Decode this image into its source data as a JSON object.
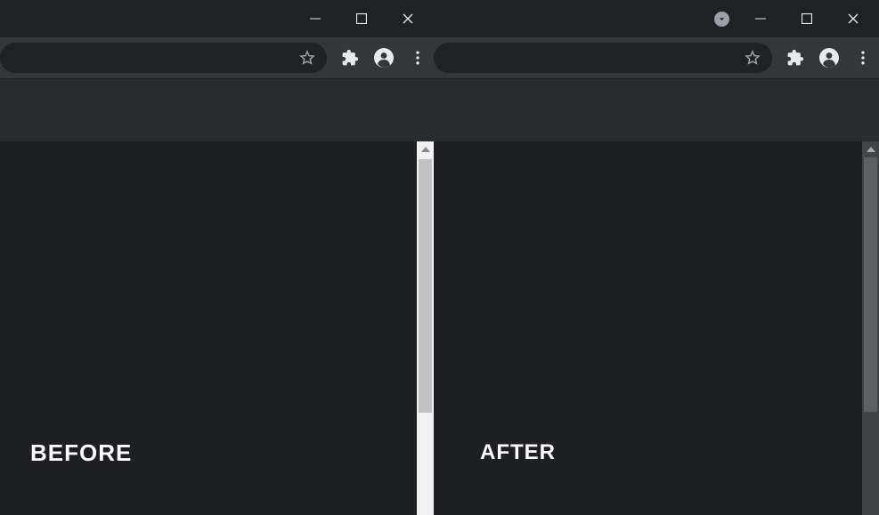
{
  "left": {
    "label": "BEFORE"
  },
  "right": {
    "label": "AFTER"
  },
  "icons": {
    "star": "star-outline-icon",
    "puzzle": "extensions-icon",
    "avatar": "profile-avatar-icon",
    "menu": "menu-kebab-icon",
    "minimize": "window-minimize-icon",
    "maximize": "window-maximize-icon",
    "close": "window-close-icon",
    "dropdown": "dropdown-triangle-icon"
  }
}
